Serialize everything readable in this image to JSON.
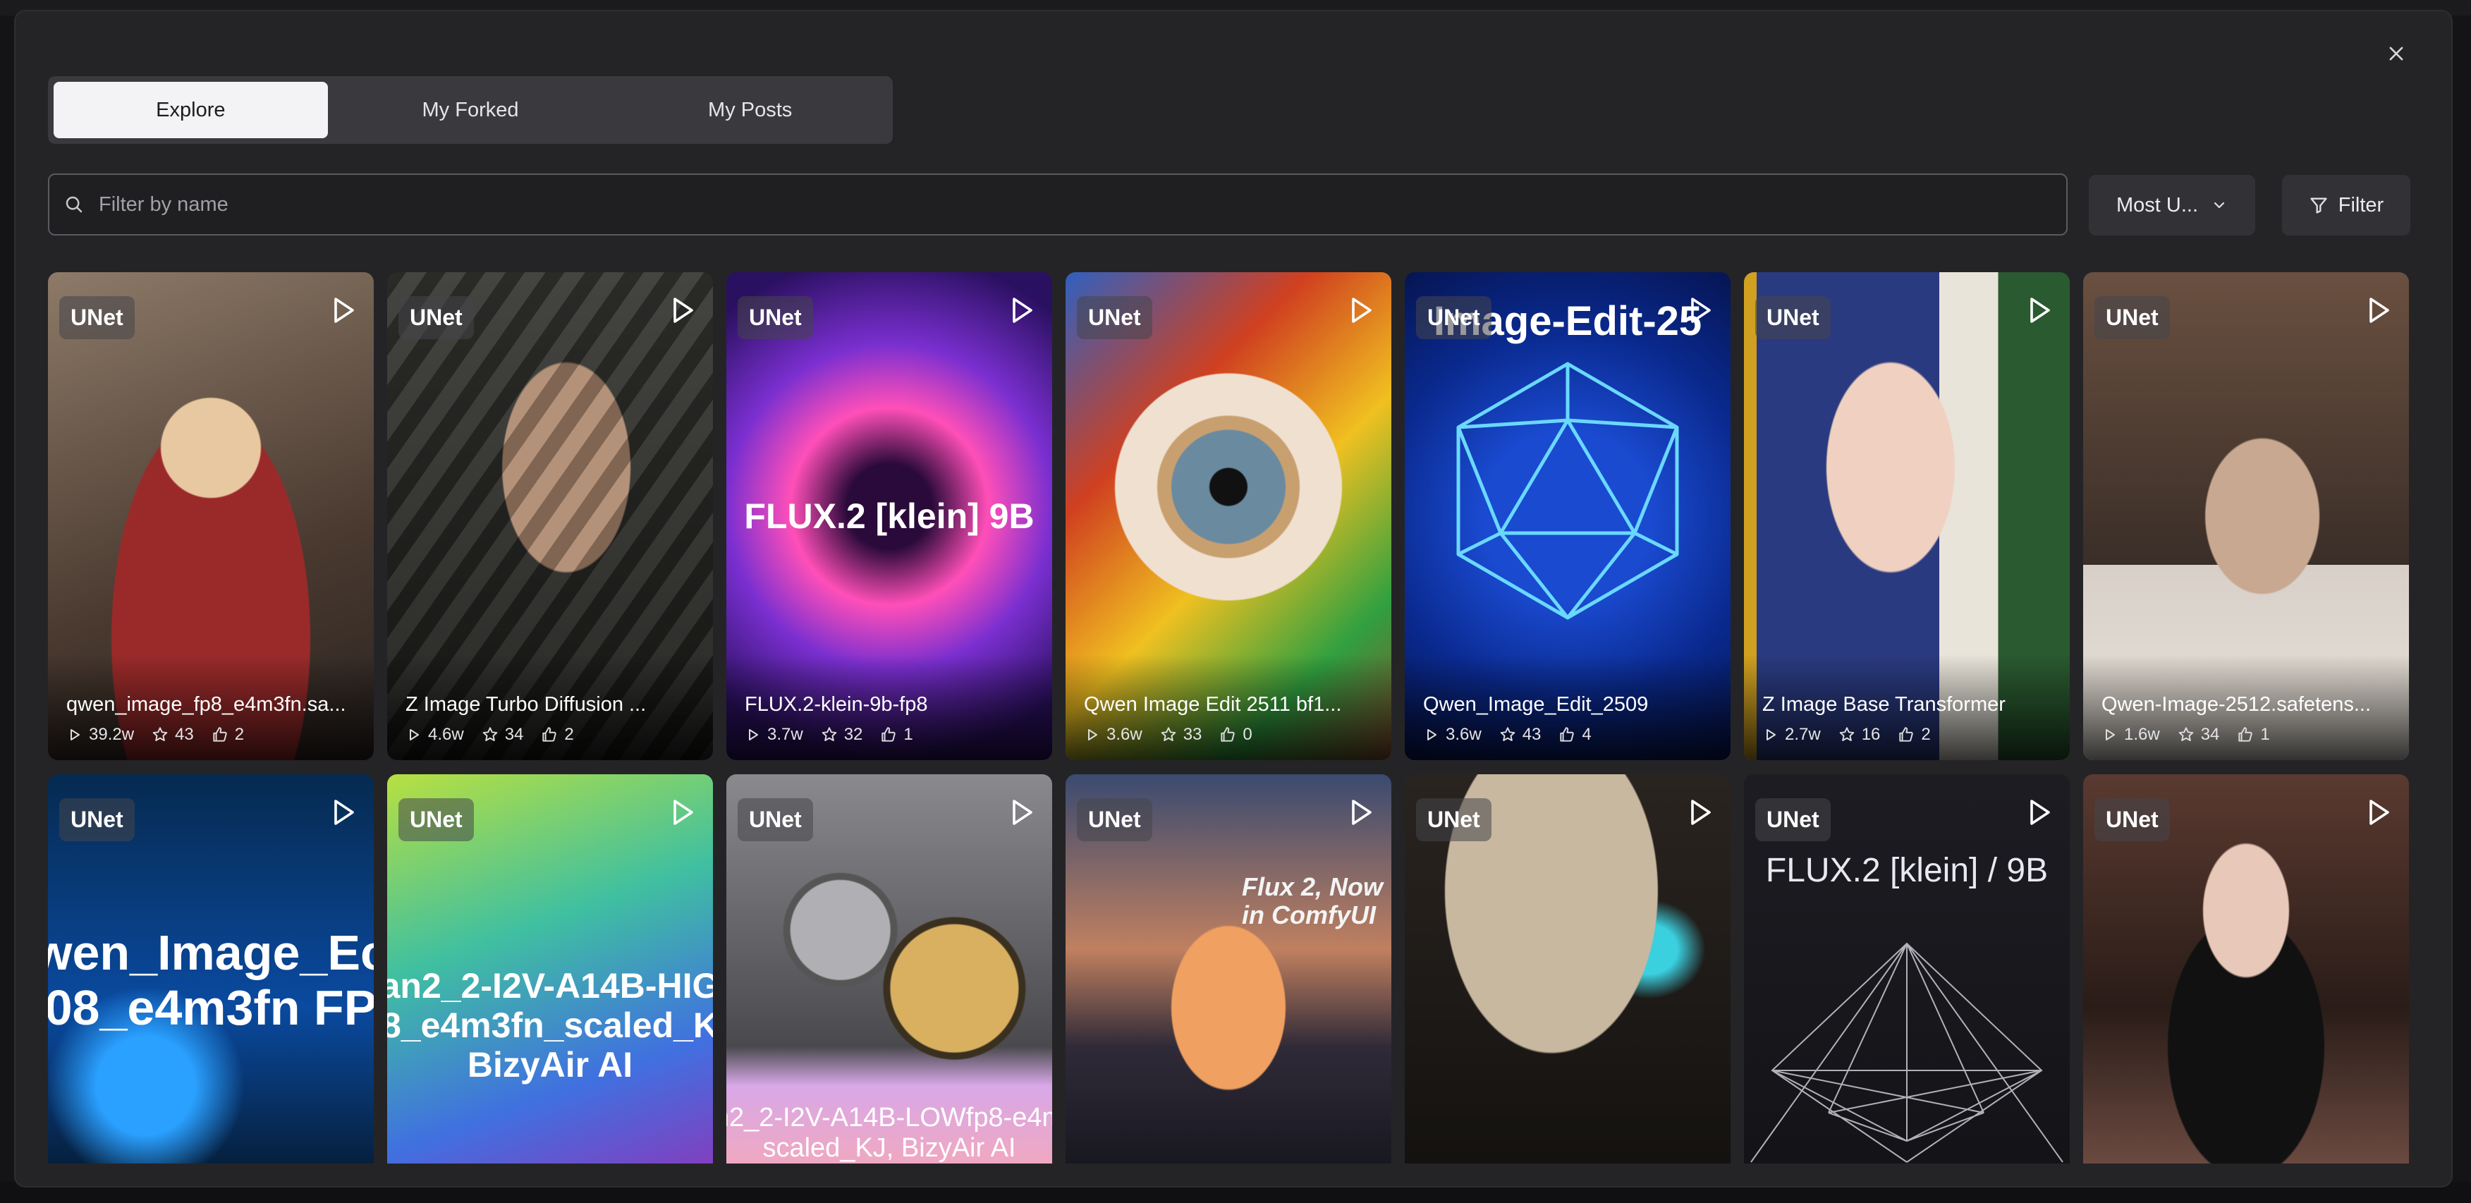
{
  "tabs": [
    {
      "label": "Explore",
      "active": true
    },
    {
      "label": "My Forked",
      "active": false
    },
    {
      "label": "My Posts",
      "active": false
    }
  ],
  "search": {
    "placeholder": "Filter by name",
    "value": ""
  },
  "sort": {
    "label": "Most U..."
  },
  "filter": {
    "label": "Filter"
  },
  "icons": {
    "close": "close-icon",
    "search": "search-icon",
    "chevron": "chevron-down-icon",
    "filter": "filter-icon",
    "play": "play-icon",
    "runs": "play-small-icon",
    "stars": "star-icon",
    "likes": "thumbs-up-icon"
  },
  "cards": [
    {
      "badge": "UNet",
      "cover_text": "",
      "title": "qwen_image_fp8_e4m3fn.sa...",
      "runs": "39.2w",
      "stars": "43",
      "likes": "2"
    },
    {
      "badge": "UNet",
      "cover_text": "",
      "title": "Z Image Turbo Diffusion ...",
      "runs": "4.6w",
      "stars": "34",
      "likes": "2"
    },
    {
      "badge": "UNet",
      "cover_text": "FLUX.2 [klein] 9B",
      "title": "FLUX.2-klein-9b-fp8",
      "runs": "3.7w",
      "stars": "32",
      "likes": "1"
    },
    {
      "badge": "UNet",
      "cover_text": "",
      "title": "Qwen Image Edit 2511 bf1...",
      "runs": "3.6w",
      "stars": "33",
      "likes": "0"
    },
    {
      "badge": "UNet",
      "cover_text": "Image-Edit-25",
      "title": "Qwen_Image_Edit_2509",
      "runs": "3.6w",
      "stars": "43",
      "likes": "4"
    },
    {
      "badge": "UNet",
      "cover_text": "",
      "title": "Z Image Base Transformer",
      "runs": "2.7w",
      "stars": "16",
      "likes": "2"
    },
    {
      "badge": "UNet",
      "cover_text": "",
      "title": "Qwen-Image-2512.safetens...",
      "runs": "1.6w",
      "stars": "34",
      "likes": "1"
    },
    {
      "badge": "UNet",
      "cover_text": "wen_Image_Ec\n08_e4m3fn FP"
    },
    {
      "badge": "UNet",
      "cover_text": "an2_2-I2V-A14B-HIG\n8_e4m3fn_scaled_K\nBizyAir AI"
    },
    {
      "badge": "UNet",
      "cover_text": "n2_2-I2V-A14B-LOWfp8-e4m\nscaled_KJ, BizyAir AI"
    },
    {
      "badge": "UNet",
      "cover_text": "Flux 2, Now\nin ComfyUI"
    },
    {
      "badge": "UNet",
      "cover_text": ""
    },
    {
      "badge": "UNet",
      "cover_text": "FLUX.2 [klein] / 9B"
    },
    {
      "badge": "UNet",
      "cover_text": ""
    }
  ]
}
